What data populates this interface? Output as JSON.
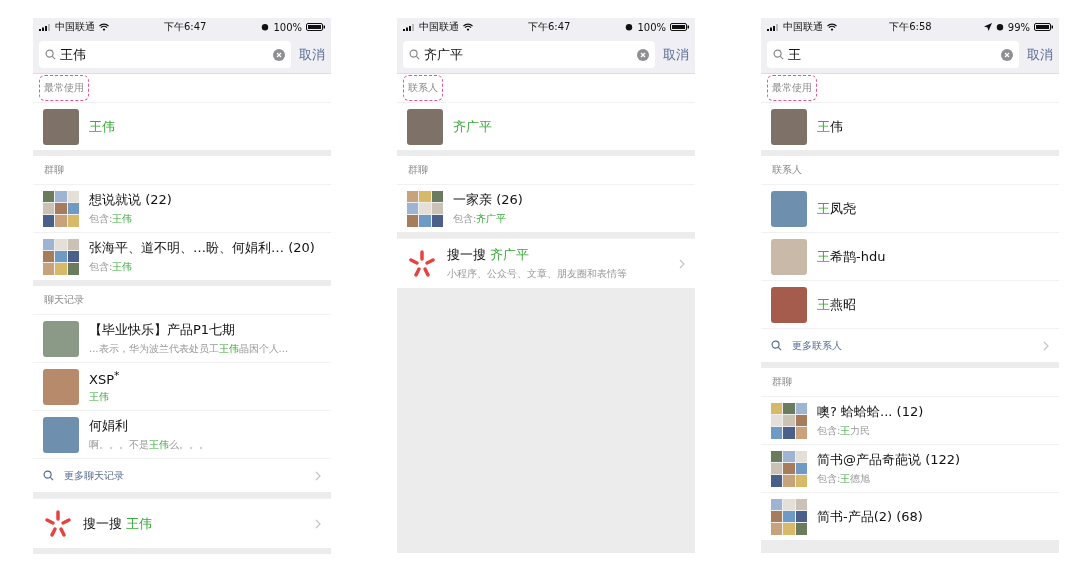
{
  "phones": [
    {
      "status": {
        "carrier": "中国联通",
        "time": "下午6:47",
        "battery": "100%",
        "location": false
      },
      "search": {
        "value": "王伟",
        "cancel": "取消"
      },
      "sections": [
        {
          "title": "最常使用",
          "highlighted": true,
          "items": [
            {
              "kind": "contact",
              "name": [
                {
                  "text": "王伟",
                  "match": true
                }
              ]
            }
          ]
        },
        {
          "title": "群聊",
          "highlighted": false,
          "items": [
            {
              "kind": "group",
              "title": "想说就说 (22)",
              "subtitle": [
                {
                  "text": "包含:",
                  "match": false
                },
                {
                  "text": "王伟",
                  "match": true
                }
              ]
            },
            {
              "kind": "group",
              "title": "张海平、道不明、…盼、何娟利… (20)",
              "subtitle": [
                {
                  "text": "包含:",
                  "match": false
                },
                {
                  "text": "王伟",
                  "match": true
                }
              ]
            }
          ]
        },
        {
          "title": "聊天记录",
          "highlighted": false,
          "items": [
            {
              "kind": "chat",
              "title": "【毕业快乐】产品P1七期",
              "snippet": [
                {
                  "text": "...表示，华为波兰代表处员工",
                  "match": false
                },
                {
                  "text": "王伟",
                  "match": true
                },
                {
                  "text": "晶因个人...",
                  "match": false
                }
              ]
            },
            {
              "kind": "chat",
              "title": "XSP$^{*}$",
              "snippet": [
                {
                  "text": "王伟",
                  "match": true
                }
              ]
            },
            {
              "kind": "chat",
              "title": "何娟利",
              "snippet": [
                {
                  "text": "啊。。。不是",
                  "match": false
                },
                {
                  "text": "王伟",
                  "match": true
                },
                {
                  "text": "么。。。",
                  "match": false
                }
              ]
            },
            {
              "kind": "more",
              "label": "更多聊天记录"
            }
          ]
        },
        {
          "items": [
            {
              "kind": "sousou",
              "title": "搜一搜",
              "keyword": "王伟"
            }
          ]
        }
      ]
    },
    {
      "status": {
        "carrier": "中国联通",
        "time": "下午6:47",
        "battery": "100%",
        "location": false
      },
      "search": {
        "value": "齐广平",
        "cancel": "取消"
      },
      "sections": [
        {
          "title": "联系人",
          "highlighted": true,
          "items": [
            {
              "kind": "contact",
              "name": [
                {
                  "text": "齐广平",
                  "match": true
                }
              ]
            }
          ]
        },
        {
          "title": "群聊",
          "highlighted": false,
          "items": [
            {
              "kind": "group",
              "title": "一家亲 (26)",
              "subtitle": [
                {
                  "text": "包含:",
                  "match": false
                },
                {
                  "text": "齐广平",
                  "match": true
                }
              ]
            }
          ]
        },
        {
          "items": [
            {
              "kind": "sousou",
              "title": "搜一搜",
              "keyword": "齐广平",
              "subtitle": "小程序、公众号、文章、朋友圈和表情等"
            }
          ]
        }
      ]
    },
    {
      "status": {
        "carrier": "中国联通",
        "time": "下午6:58",
        "battery": "99%",
        "location": true
      },
      "search": {
        "value": "王",
        "cancel": "取消"
      },
      "sections": [
        {
          "title": "最常使用",
          "highlighted": true,
          "items": [
            {
              "kind": "contact",
              "name": [
                {
                  "text": "王",
                  "match": true
                },
                {
                  "text": "伟",
                  "match": false
                }
              ]
            }
          ]
        },
        {
          "title": "联系人",
          "highlighted": false,
          "items": [
            {
              "kind": "contact",
              "name": [
                {
                  "text": "王",
                  "match": true
                },
                {
                  "text": "凤尧",
                  "match": false
                }
              ]
            },
            {
              "kind": "contact",
              "name": [
                {
                  "text": "王",
                  "match": true
                },
                {
                  "text": "希鹊-hdu",
                  "match": false
                }
              ]
            },
            {
              "kind": "contact",
              "name": [
                {
                  "text": "王",
                  "match": true
                },
                {
                  "text": "燕昭",
                  "match": false
                }
              ]
            },
            {
              "kind": "more",
              "label": "更多联系人"
            }
          ]
        },
        {
          "title": "群聊",
          "highlighted": false,
          "items": [
            {
              "kind": "group",
              "title": "噢? 蛤蛤蛤... (12)",
              "subtitle": [
                {
                  "text": "包含:",
                  "match": false
                },
                {
                  "text": "王",
                  "match": true
                },
                {
                  "text": "力民",
                  "match": false
                }
              ]
            },
            {
              "kind": "group",
              "title": "简书@产品奇葩说 (122)",
              "subtitle": [
                {
                  "text": "包含:",
                  "match": false
                },
                {
                  "text": "王",
                  "match": true
                },
                {
                  "text": "德旭",
                  "match": false
                }
              ]
            },
            {
              "kind": "group",
              "title": "简书-产品(2) (68)"
            }
          ]
        }
      ]
    }
  ]
}
